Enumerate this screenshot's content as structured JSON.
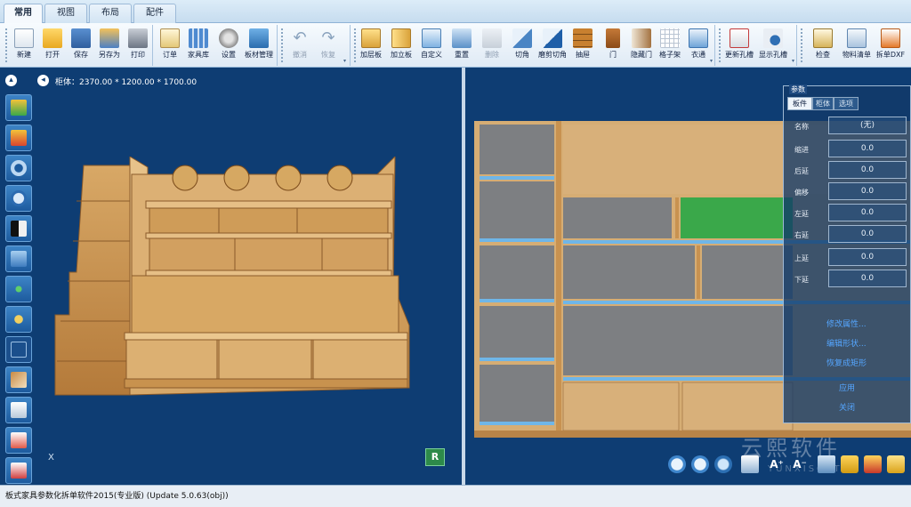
{
  "tabs": [
    "常用",
    "视图",
    "布局",
    "配件"
  ],
  "ribbon": {
    "group1": [
      "新建",
      "打开",
      "保存",
      "另存为",
      "打印"
    ],
    "group2": [
      "订单",
      "家具库",
      "设置",
      "板材管理"
    ],
    "group3": [
      "撤消",
      "恢复"
    ],
    "group4": [
      "加层板",
      "加立板",
      "自定义",
      "重置",
      "删除",
      "切角",
      "磨剪切角",
      "抽屉",
      "门",
      "隐藏门",
      "格子架",
      "衣通"
    ],
    "group5": [
      "更新孔槽",
      "显示孔槽"
    ],
    "group6": [
      "检查",
      "物料清单",
      "拆单DXF"
    ]
  },
  "viewport": {
    "dimensions": "柜体：2370.00 * 1200.00 * 1700.00",
    "axis_x": "X",
    "view_badge": "R"
  },
  "params": {
    "title": "参数",
    "tabs": [
      "板件",
      "柜体",
      "选项"
    ],
    "rows": [
      {
        "label": "名称",
        "value": "(无)"
      },
      {
        "label": "缩进",
        "value": "0.0"
      },
      {
        "label": "后延",
        "value": "0.0"
      },
      {
        "label": "偏移",
        "value": "0.0"
      },
      {
        "label": "左延",
        "value": "0.0"
      },
      {
        "label": "右延",
        "value": "0.0"
      },
      {
        "label": "上延",
        "value": "0.0"
      },
      {
        "label": "下延",
        "value": "0.0"
      }
    ],
    "links": [
      "修改属性...",
      "编辑形状...",
      "恢复成矩形",
      "应用",
      "关闭"
    ]
  },
  "watermark": {
    "cn": "云熙软件",
    "en": "YUNXISOFT"
  },
  "status": "板式家具参数化拆单软件2015(专业版) (Update 5.0.63(obj))",
  "colors": {
    "accent": "#2a7bd0",
    "wood": "#d9b27b",
    "panel_gray": "#7d7f82",
    "selected": "#3aa84a"
  }
}
